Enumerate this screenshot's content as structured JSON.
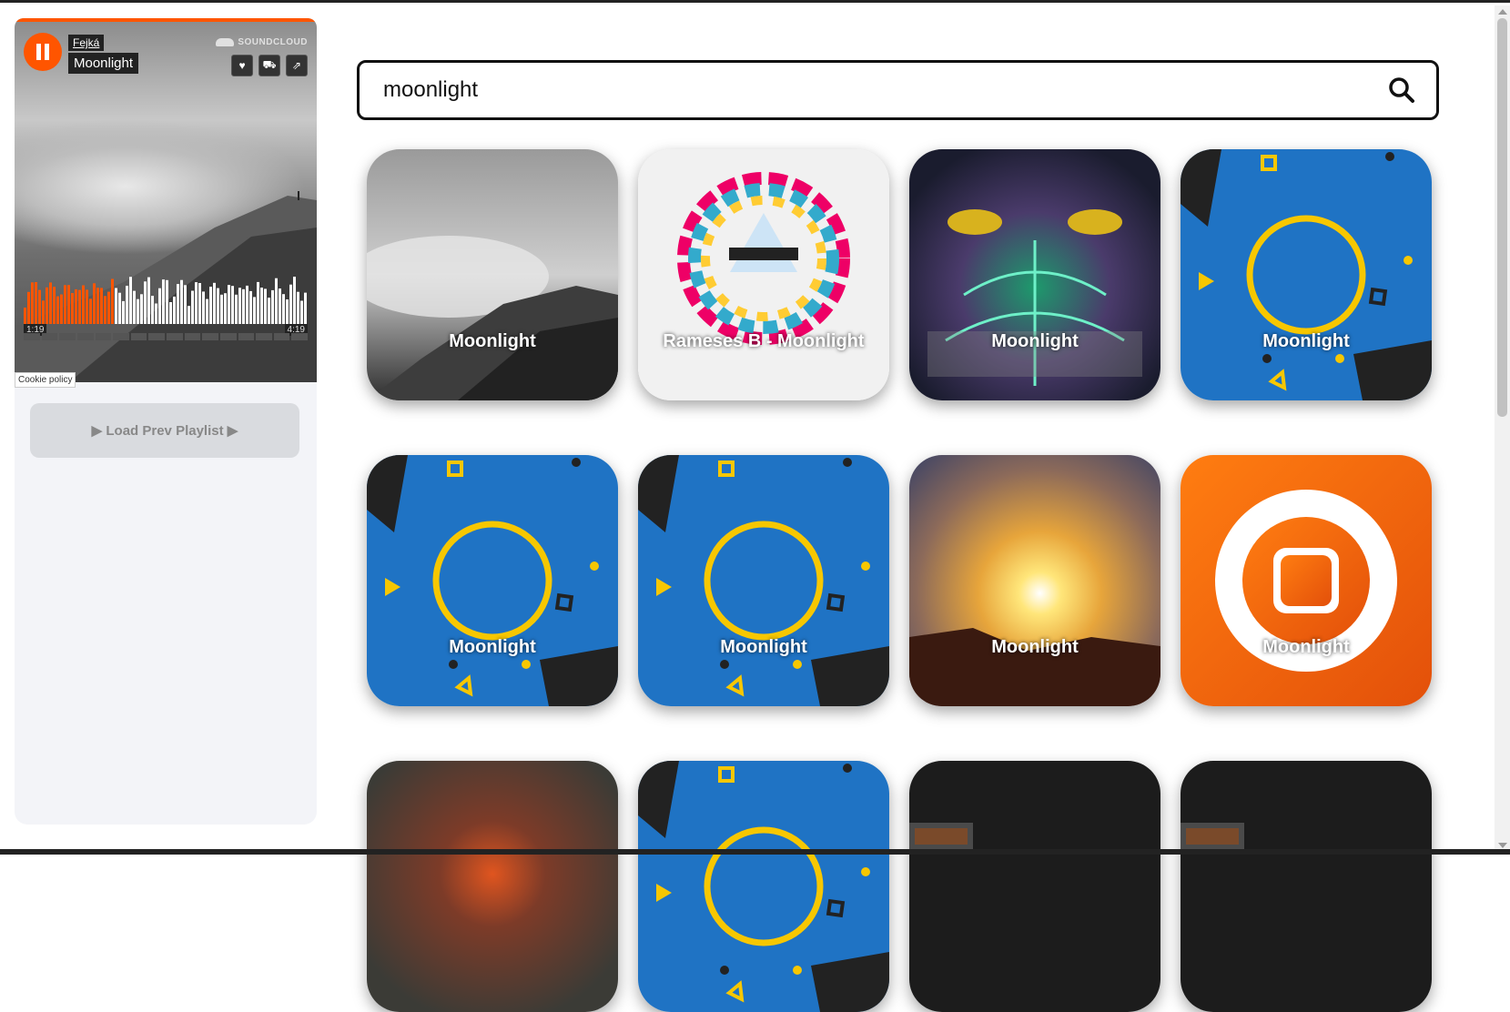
{
  "player": {
    "artist": "Fejká",
    "title": "Moonlight",
    "brand": "SOUNDCLOUD",
    "time_elapsed": "1:19",
    "time_total": "4:19",
    "progress": 0.31,
    "accent_color": "#ff5500",
    "actions": [
      {
        "icon": "heart-icon",
        "glyph": "♥"
      },
      {
        "icon": "cart-icon",
        "glyph": "🛒"
      },
      {
        "icon": "share-icon",
        "glyph": "⇪"
      }
    ]
  },
  "cookie_label": "Cookie policy",
  "load_prev_label": "▶ Load Prev Playlist ▶",
  "search": {
    "value": "moonlight",
    "icon": "search-icon"
  },
  "results": [
    {
      "label": "Moonlight",
      "art": "mountain-bw"
    },
    {
      "label": "Rameses B - Moonlight",
      "art": "inspire-ring"
    },
    {
      "label": "Moonlight",
      "art": "psychedelic-owl"
    },
    {
      "label": "Moonlight",
      "art": "blue-circle"
    },
    {
      "label": "Moonlight",
      "art": "blue-circle"
    },
    {
      "label": "Moonlight",
      "art": "blue-circle"
    },
    {
      "label": "Moonlight",
      "art": "sunrise"
    },
    {
      "label": "Moonlight",
      "art": "orange-record"
    },
    {
      "label": "",
      "art": "dark-red-blur"
    },
    {
      "label": "",
      "art": "blue-circle"
    },
    {
      "label": "",
      "art": "dark-screen"
    },
    {
      "label": "",
      "art": "dark-screen"
    }
  ]
}
